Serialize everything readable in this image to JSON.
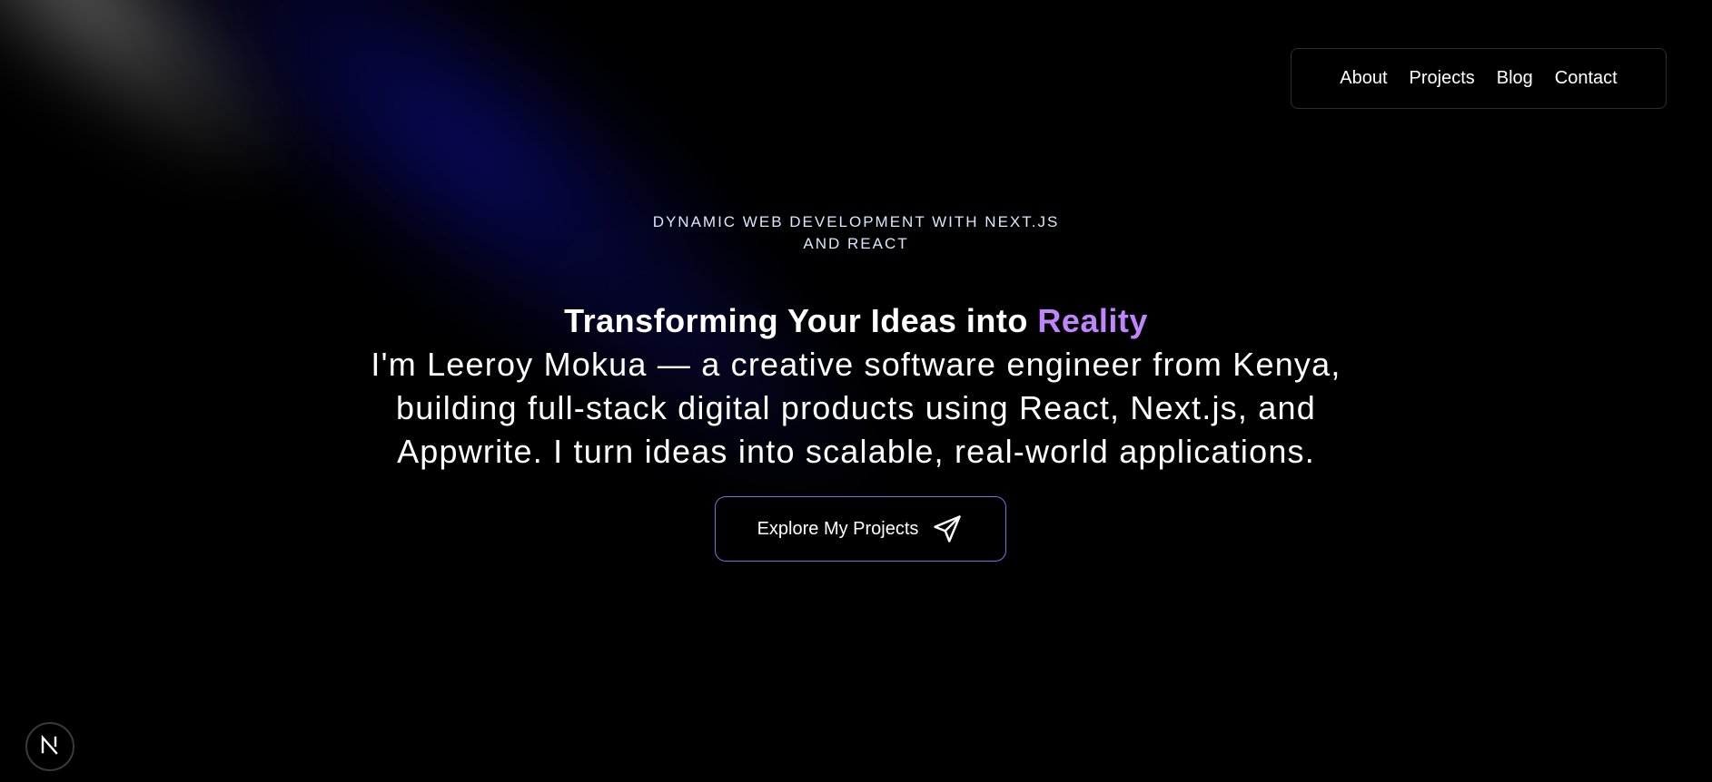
{
  "nav": {
    "items": [
      {
        "label": "About"
      },
      {
        "label": "Projects"
      },
      {
        "label": "Blog"
      },
      {
        "label": "Contact"
      }
    ]
  },
  "hero": {
    "eyebrow_line1": "DYNAMIC WEB DEVELOPMENT WITH NEXT.JS",
    "eyebrow_line2": "AND REACT",
    "headline_prefix": "Transforming Your Ideas into",
    "headline_accent": "Reality",
    "intro": "I'm Leeroy Mokua — a creative software engineer from Kenya, building full-stack digital products using React, Next.js, and Appwrite. I turn ideas into scalable, real-world applications.",
    "cta_label": "Explore My Projects",
    "cta_icon": "send-icon"
  },
  "badge": {
    "icon": "nextjs-logo-icon"
  },
  "colors": {
    "background": "#000000",
    "accent": "#c084fc",
    "cta_border": "#7c6fe0",
    "eyebrow": "#dbe7ff"
  }
}
